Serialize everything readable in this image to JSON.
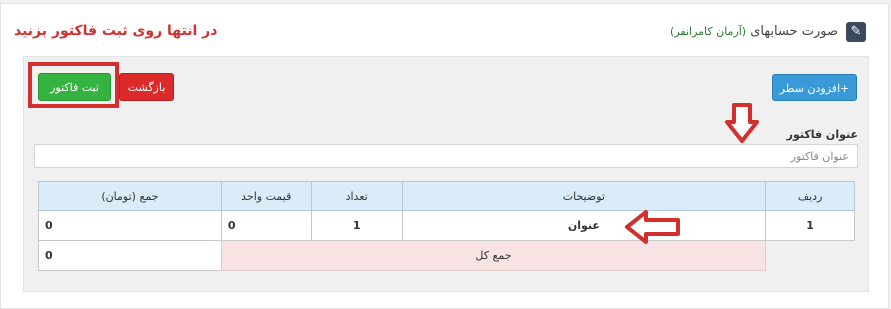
{
  "header": {
    "title": "صورت حسابهای",
    "subtitle": "(آرمان کامرانفر)",
    "icon": "document-icon"
  },
  "instruction": "در انتها روی ثبت فاکتور بزنید",
  "toolbar": {
    "submit_label": "ثبت فاکتور",
    "back_label": "بازگشت",
    "add_row_label": "+افزودن سطر"
  },
  "invoice_title": {
    "label": "عنوان فاکتور",
    "placeholder": "عنوان فاکتور"
  },
  "table": {
    "headers": {
      "row": "ردیف",
      "description": "توضیحات",
      "quantity": "تعداد",
      "unit_price": "قیمت واحد",
      "total": "جمع (تومان)"
    },
    "rows": [
      {
        "row": "1",
        "description": "عنوان",
        "quantity": "1",
        "unit_price": "0",
        "total": "0"
      }
    ],
    "grand_total_label": "جمع کل",
    "grand_total_value": "0"
  },
  "colors": {
    "submit": "#34b341",
    "back": "#dc2a2a",
    "add": "#3a9ad8",
    "annotation": "#d32f2f"
  }
}
